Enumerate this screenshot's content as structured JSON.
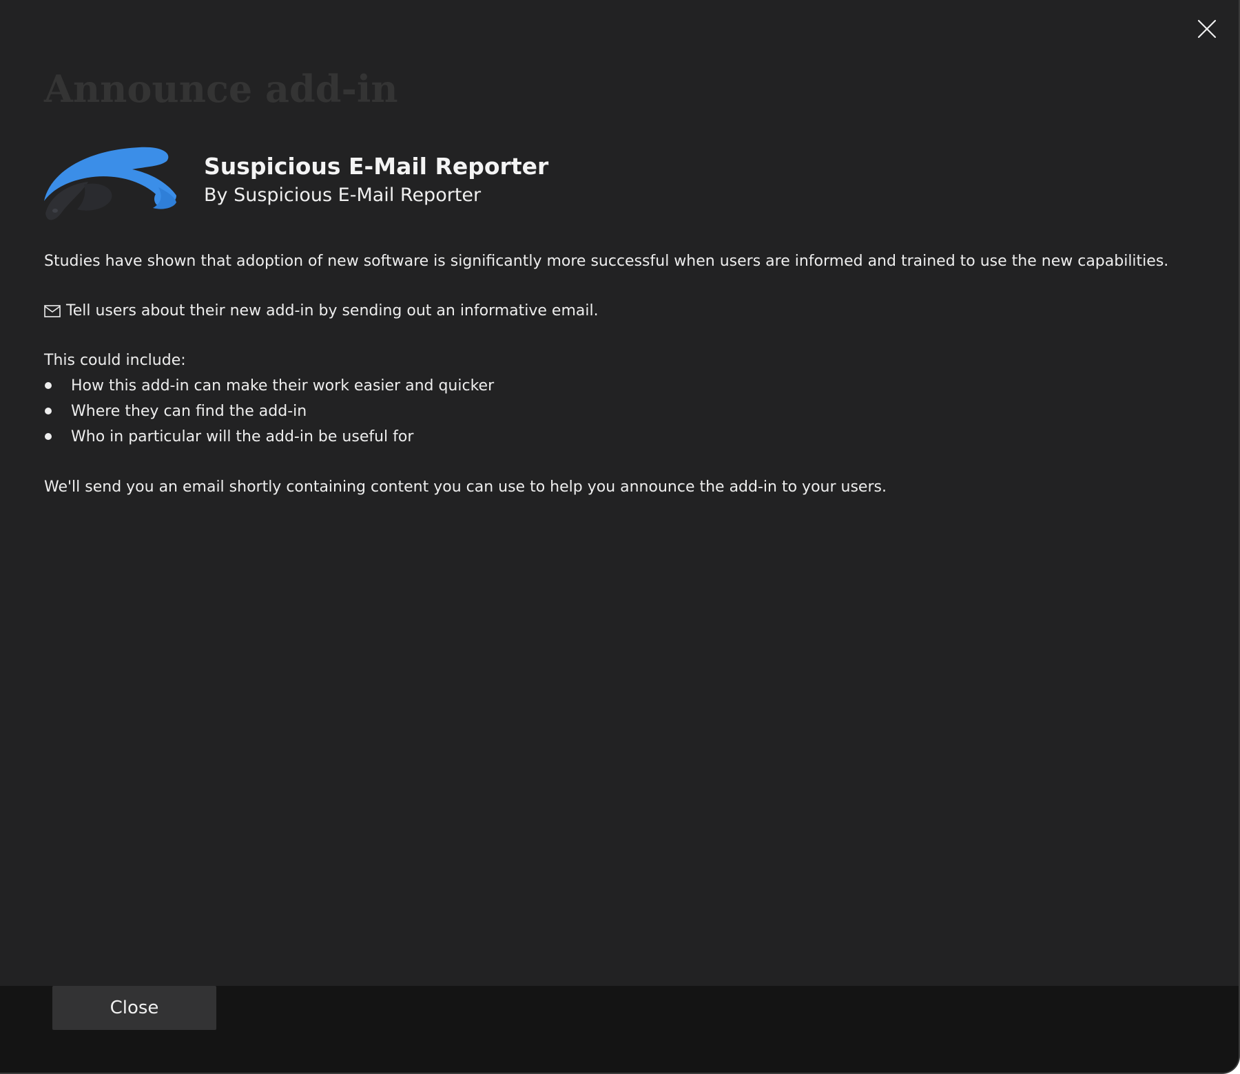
{
  "dialog": {
    "title": "Announce add-in",
    "close_icon": "close-icon"
  },
  "app": {
    "name": "Suspicious E-Mail Reporter",
    "publisher": "By Suspicious E-Mail Reporter",
    "logo_icon": "suspicious-email-reporter-logo",
    "logo_color": "#3b8ee8"
  },
  "content": {
    "intro": "Studies have shown that adoption of new software is significantly more successful when users are informed and trained to use the new capabilities.",
    "email_icon": "mail-icon",
    "email_text": "Tell users about their new add-in by sending out an informative email.",
    "include_heading": "This could include:",
    "bullets": [
      "How this add-in can make their work easier and quicker",
      "Where they can find the add-in",
      "Who in particular will the add-in be useful for"
    ],
    "followup": "We'll send you an email shortly containing content you can use to help you announce the add-in to your users."
  },
  "footer": {
    "close_label": "Close"
  },
  "colors": {
    "background": "#222223",
    "footer_background": "#141414",
    "button_background": "#333334",
    "text": "#f2f2f2",
    "title_text": "#343434"
  }
}
